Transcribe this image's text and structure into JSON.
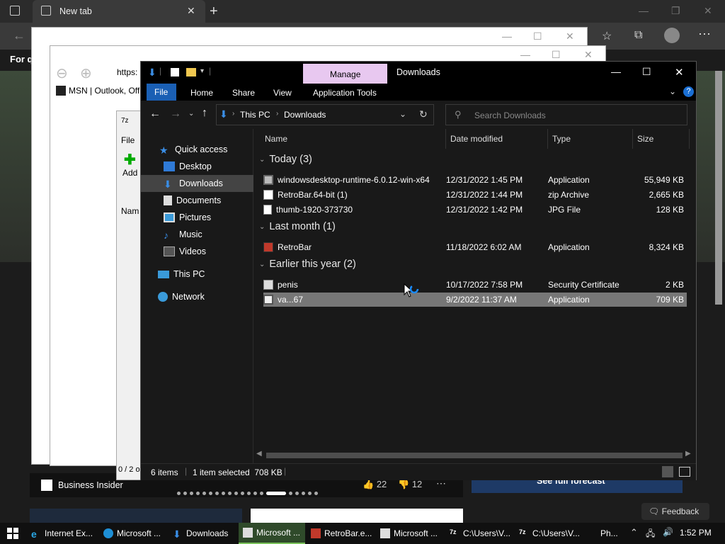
{
  "edge": {
    "tab_title": "New tab",
    "feedback": "Feedback",
    "business_insider": "Business Insider",
    "likes": "22",
    "dislikes": "12",
    "forecast": "See full forecast"
  },
  "ie_window": {
    "address": "https:",
    "msn_tab": "MSN | Outlook, Off"
  },
  "zip_window": {
    "menu_file": "File",
    "add": "Add",
    "col_name": "Nam",
    "status": "0 / 2 o"
  },
  "explorer": {
    "title": "Downloads",
    "manage": "Manage",
    "ribbon": [
      "File",
      "Home",
      "Share",
      "View",
      "Application Tools"
    ],
    "breadcrumb": [
      "This PC",
      "Downloads"
    ],
    "search_placeholder": "Search Downloads",
    "columns": {
      "name": "Name",
      "date": "Date modified",
      "type": "Type",
      "size": "Size"
    },
    "nav": {
      "quick_access": "Quick access",
      "desktop": "Desktop",
      "downloads": "Downloads",
      "documents": "Documents",
      "pictures": "Pictures",
      "music": "Music",
      "videos": "Videos",
      "this_pc": "This PC",
      "network": "Network"
    },
    "groups": [
      {
        "label": "Today (3)",
        "files": [
          {
            "name": "windowsdesktop-runtime-6.0.12-win-x64",
            "date": "12/31/2022 1:45 PM",
            "type": "Application",
            "size": "55,949 KB"
          },
          {
            "name": "RetroBar.64-bit (1)",
            "date": "12/31/2022 1:44 PM",
            "type": "zip Archive",
            "size": "2,665 KB"
          },
          {
            "name": "thumb-1920-373730",
            "date": "12/31/2022 1:42 PM",
            "type": "JPG File",
            "size": "128 KB"
          }
        ]
      },
      {
        "label": "Last month (1)",
        "files": [
          {
            "name": "RetroBar",
            "date": "11/18/2022 6:02 AM",
            "type": "Application",
            "size": "8,324 KB"
          }
        ]
      },
      {
        "label": "Earlier this year (2)",
        "files": [
          {
            "name": "penis",
            "date": "10/17/2022 7:58 PM",
            "type": "Security Certificate",
            "size": "2 KB"
          },
          {
            "name": "va...67",
            "date": "9/2/2022 11:37 AM",
            "type": "Application",
            "size": "709 KB"
          }
        ]
      }
    ],
    "status": {
      "items": "6 items",
      "selected": "1 item selected  708 KB"
    }
  },
  "taskbar": {
    "items": [
      "Internet Ex...",
      "Microsoft ...",
      "Downloads",
      "Microsoft ...",
      "RetroBar.e...",
      "Microsoft ...",
      "C:\\Users\\V...",
      "C:\\Users\\V...",
      "Ph..."
    ],
    "clock": "1:52 PM"
  },
  "colors": {
    "accent": "#0078d7",
    "manage_tab": "#e8c8f0",
    "selection": "#777777",
    "taskbar_active": "#7ac25a"
  }
}
